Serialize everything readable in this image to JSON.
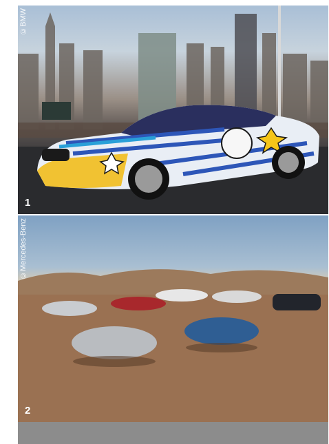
{
  "photos": [
    {
      "number": "1",
      "credit": "©BMW"
    },
    {
      "number": "2",
      "credit": "©Mercedes-Benz"
    }
  ],
  "colors": {
    "footer_bar": "#8c8c8c",
    "label_text": "#ffffff"
  }
}
